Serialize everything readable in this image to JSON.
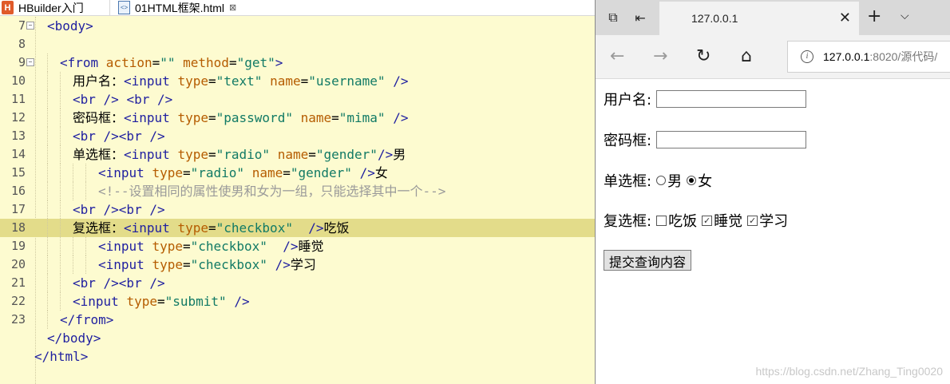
{
  "editor": {
    "tabs": [
      {
        "label": "HBuilder入门",
        "icon": "hbuilder-icon"
      },
      {
        "label": "01HTML框架.html",
        "icon": "html-file-icon",
        "close": "⊠"
      }
    ],
    "lines": [
      {
        "num": "7",
        "fold": "−",
        "indent": 2,
        "tokens": [
          [
            "t",
            "<body>"
          ]
        ]
      },
      {
        "num": "8",
        "indent": 0,
        "tokens": []
      },
      {
        "num": "9",
        "fold": "−",
        "indent": 4,
        "tokens": [
          [
            "t",
            "<from "
          ],
          [
            "a",
            "action"
          ],
          [
            "tx",
            "="
          ],
          [
            "v",
            "\"\""
          ],
          [
            "tx",
            " "
          ],
          [
            "a",
            "method"
          ],
          [
            "tx",
            "="
          ],
          [
            "v",
            "\"get\""
          ],
          [
            "t",
            ">"
          ]
        ]
      },
      {
        "num": "10",
        "indent": 6,
        "tokens": [
          [
            "tx",
            "用户名："
          ],
          [
            "t",
            "<input "
          ],
          [
            "a",
            "type"
          ],
          [
            "tx",
            "="
          ],
          [
            "v",
            "\"text\""
          ],
          [
            "tx",
            " "
          ],
          [
            "a",
            "name"
          ],
          [
            "tx",
            "="
          ],
          [
            "v",
            "\"username\""
          ],
          [
            "tx",
            " "
          ],
          [
            "t",
            "/>"
          ]
        ]
      },
      {
        "num": "11",
        "indent": 6,
        "tokens": [
          [
            "t",
            "<br />"
          ],
          [
            "tx",
            " "
          ],
          [
            "t",
            "<br />"
          ]
        ]
      },
      {
        "num": "12",
        "indent": 6,
        "tokens": [
          [
            "tx",
            "密码框："
          ],
          [
            "t",
            "<input "
          ],
          [
            "a",
            "type"
          ],
          [
            "tx",
            "="
          ],
          [
            "v",
            "\"password\""
          ],
          [
            "tx",
            " "
          ],
          [
            "a",
            "name"
          ],
          [
            "tx",
            "="
          ],
          [
            "v",
            "\"mima\""
          ],
          [
            "tx",
            " "
          ],
          [
            "t",
            "/>"
          ]
        ]
      },
      {
        "num": "13",
        "indent": 6,
        "tokens": [
          [
            "t",
            "<br />"
          ],
          [
            "t",
            "<br />"
          ]
        ]
      },
      {
        "num": "14",
        "indent": 6,
        "tokens": [
          [
            "tx",
            "单选框："
          ],
          [
            "t",
            "<input "
          ],
          [
            "a",
            "type"
          ],
          [
            "tx",
            "="
          ],
          [
            "v",
            "\"radio\""
          ],
          [
            "tx",
            " "
          ],
          [
            "a",
            "name"
          ],
          [
            "tx",
            "="
          ],
          [
            "v",
            "\"gender\""
          ],
          [
            "t",
            "/>"
          ],
          [
            "tx",
            "男"
          ]
        ]
      },
      {
        "num": "15",
        "indent": 10,
        "tokens": [
          [
            "t",
            "<input "
          ],
          [
            "a",
            "type"
          ],
          [
            "tx",
            "="
          ],
          [
            "v",
            "\"radio\""
          ],
          [
            "tx",
            " "
          ],
          [
            "a",
            "name"
          ],
          [
            "tx",
            "="
          ],
          [
            "v",
            "\"gender\""
          ],
          [
            "tx",
            " "
          ],
          [
            "t",
            "/>"
          ],
          [
            "tx",
            "女"
          ]
        ]
      },
      {
        "num": "16",
        "indent": 10,
        "tokens": [
          [
            "cm",
            "<!--设置相同的属性使男和女为一组，只能选择其中一个-->"
          ]
        ]
      },
      {
        "num": "17",
        "indent": 6,
        "tokens": [
          [
            "t",
            "<br />"
          ],
          [
            "t",
            "<br />"
          ]
        ]
      },
      {
        "num": "18",
        "indent": 6,
        "hl": true,
        "tokens": [
          [
            "tx",
            "复选框："
          ],
          [
            "t",
            "<input "
          ],
          [
            "a",
            "type"
          ],
          [
            "tx",
            "="
          ],
          [
            "v",
            "\"checkbox\""
          ],
          [
            "tx",
            "  "
          ],
          [
            "t",
            "/>"
          ],
          [
            "tx",
            "吃饭"
          ]
        ]
      },
      {
        "num": "19",
        "indent": 10,
        "tokens": [
          [
            "t",
            "<input "
          ],
          [
            "a",
            "type"
          ],
          [
            "tx",
            "="
          ],
          [
            "v",
            "\"checkbox\""
          ],
          [
            "tx",
            "  "
          ],
          [
            "t",
            "/>"
          ],
          [
            "tx",
            "睡觉"
          ]
        ]
      },
      {
        "num": "20",
        "indent": 10,
        "tokens": [
          [
            "t",
            "<input "
          ],
          [
            "a",
            "type"
          ],
          [
            "tx",
            "="
          ],
          [
            "v",
            "\"checkbox\""
          ],
          [
            "tx",
            " "
          ],
          [
            "t",
            "/>"
          ],
          [
            "tx",
            "学习"
          ]
        ]
      },
      {
        "num": "21",
        "indent": 6,
        "tokens": [
          [
            "t",
            "<br />"
          ],
          [
            "t",
            "<br />"
          ]
        ]
      },
      {
        "num": "22",
        "indent": 6,
        "tokens": [
          [
            "t",
            "<input "
          ],
          [
            "a",
            "type"
          ],
          [
            "tx",
            "="
          ],
          [
            "v",
            "\"submit\""
          ],
          [
            "tx",
            " "
          ],
          [
            "t",
            "/>"
          ]
        ]
      },
      {
        "num": "23",
        "indent": 4,
        "tokens": [
          [
            "t",
            "</from>"
          ]
        ]
      },
      {
        "num": "",
        "indent": 2,
        "tokens": [
          [
            "t",
            "</body>"
          ]
        ]
      },
      {
        "num": "",
        "indent": 0,
        "tokens": [
          [
            "t",
            "</html>"
          ]
        ]
      }
    ]
  },
  "browser": {
    "tab_title": "127.0.0.1",
    "tab_close": "✕",
    "new_tab": "+",
    "tab_menu": "⌵",
    "address_host": "127.0.0.1",
    "address_rest": ":8020/源代码/",
    "nav": {
      "back": "←",
      "forward": "→",
      "refresh": "↻",
      "home": "⌂"
    },
    "form": {
      "username_label": "用户名:",
      "password_label": "密码框:",
      "radio_label": "单选框:",
      "radio_options": [
        "男",
        "女"
      ],
      "radio_selected": "女",
      "checkbox_label": "复选框:",
      "checkbox_options": [
        "吃饭",
        "睡觉",
        "学习"
      ],
      "checkbox_checked": [
        false,
        true,
        true
      ],
      "submit_label": "提交查询内容"
    },
    "watermark": "https://blog.csdn.net/Zhang_Ting0020"
  }
}
